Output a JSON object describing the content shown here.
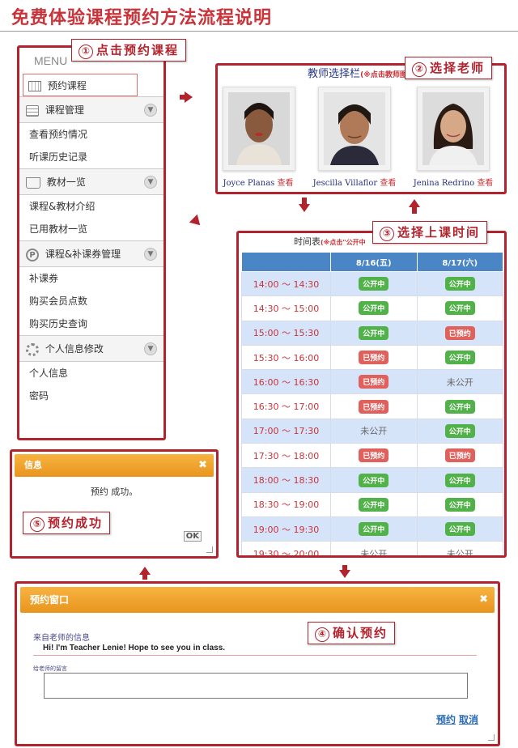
{
  "page": {
    "title": "免费体验课程预约方法流程说明"
  },
  "steps": {
    "s1": {
      "num": "①",
      "label": "点击预约课程"
    },
    "s2": {
      "num": "②",
      "label": "选择老师"
    },
    "s3": {
      "num": "③",
      "label": "选择上课时间"
    },
    "s4": {
      "num": "④",
      "label": "确认预约"
    },
    "s5": {
      "num": "⑤",
      "label": "预约成功"
    }
  },
  "menu": {
    "header": "MENU",
    "book_label": "预约课程",
    "sections": [
      {
        "title": "课程管理",
        "icon": "list-icon",
        "items": [
          "查看预约情况",
          "听课历史记录"
        ]
      },
      {
        "title": "教材一览",
        "icon": "book-icon",
        "items": [
          "课程&教材介绍",
          "已用教材一览"
        ]
      },
      {
        "title": "课程&补课券管理",
        "icon": "coupon-icon",
        "items": [
          "补课券",
          "购买会员点数",
          "购买历史查询"
        ]
      },
      {
        "title": "个人信息修改",
        "icon": "gear-icon",
        "items": [
          "个人信息",
          "密码"
        ]
      }
    ]
  },
  "teachers": {
    "header": "教师选择栏",
    "hint": "(※点击教师图片",
    "see_label": "查看",
    "list": [
      {
        "name": "Joyce Planas"
      },
      {
        "name": "Jescilla Villaflor"
      },
      {
        "name": "Jenina Redrino"
      }
    ]
  },
  "timetable": {
    "header": "时间表",
    "hint": "(※点击\"公开中",
    "columns": [
      "",
      "8/16(五)",
      "8/17(六)"
    ],
    "rows": [
      {
        "time": "14:00 ～ 14:30",
        "d1": "公开中",
        "d2": "公开中"
      },
      {
        "time": "14:30 ～ 15:00",
        "d1": "公开中",
        "d2": "公开中"
      },
      {
        "time": "15:00 ～ 15:30",
        "d1": "公开中",
        "d2": "已预约"
      },
      {
        "time": "15:30 ～ 16:00",
        "d1": "已预约",
        "d2": "公开中"
      },
      {
        "time": "16:00 ～ 16:30",
        "d1": "已预约",
        "d2": "未公开"
      },
      {
        "time": "16:30 ～ 17:00",
        "d1": "已预约",
        "d2": "公开中"
      },
      {
        "time": "17:00 ～ 17:30",
        "d1": "未公开",
        "d2": "公开中"
      },
      {
        "time": "17:30 ～ 18:00",
        "d1": "已预约",
        "d2": "已预约"
      },
      {
        "time": "18:00 ～ 18:30",
        "d1": "公开中",
        "d2": "公开中"
      },
      {
        "time": "18:30 ～ 19:00",
        "d1": "公开中",
        "d2": "公开中"
      },
      {
        "time": "19:00 ～ 19:30",
        "d1": "公开中",
        "d2": "公开中"
      },
      {
        "time": "19:30 ～ 20:00",
        "d1": "未公开",
        "d2": "未公开"
      }
    ]
  },
  "info_dialog": {
    "title": "信息",
    "message": "预约 成功。",
    "ok": "OK"
  },
  "booking_dialog": {
    "title": "预约窗口",
    "from_teacher_label": "来自老师的信息",
    "teacher_message": "Hi! I'm Teacher Lenie! Hope to see you in class.",
    "to_teacher_label": "给老师的留言",
    "message_value": "",
    "book_button": "预约",
    "cancel_button": "取消"
  },
  "colors": {
    "accent_red": "#b3232d",
    "dialog_orange": "#f0a22e",
    "open_green": "#52b24a",
    "booked_red": "#e0605c",
    "header_blue": "#4a86c6"
  }
}
